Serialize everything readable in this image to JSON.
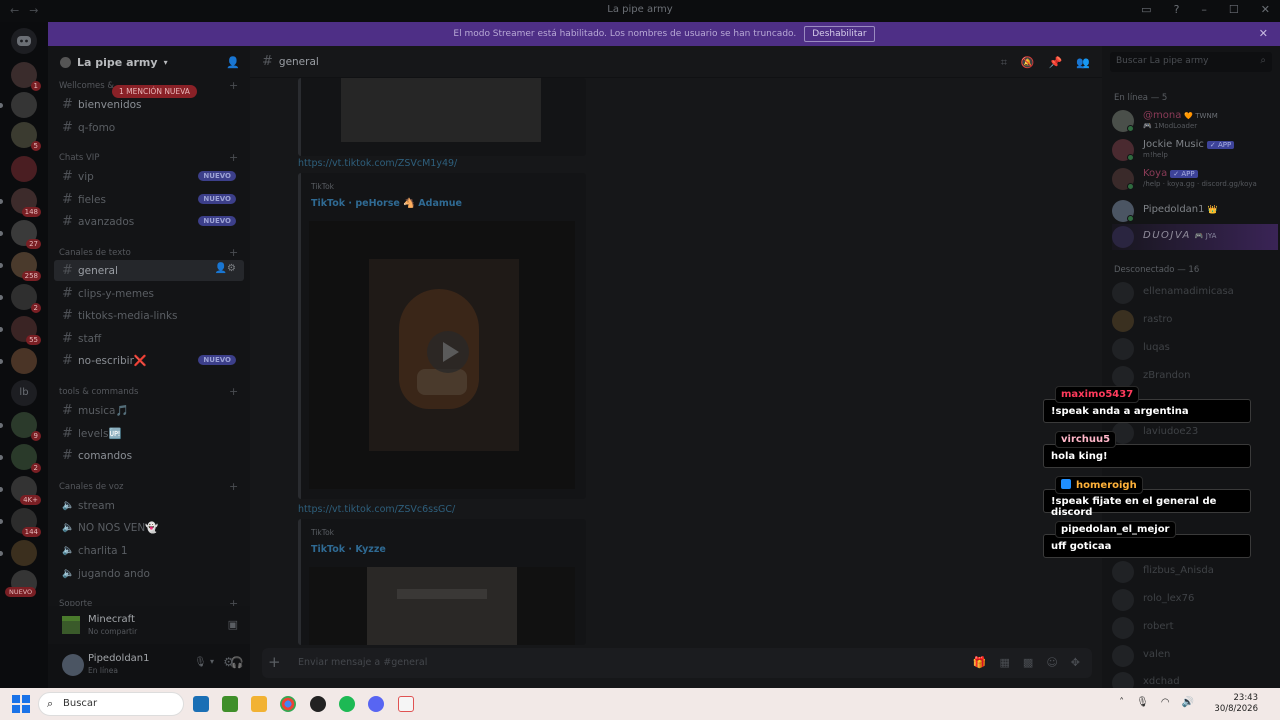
{
  "window": {
    "title": "La pipe army"
  },
  "banner": {
    "text": "El modo Streamer está habilitado. Los nombres de usuario se han truncado.",
    "button": "Deshabilitar"
  },
  "rail_badges": [
    "1",
    "5",
    "148",
    "27",
    "258",
    "2",
    "55",
    "9",
    "2",
    "4K+",
    "144"
  ],
  "rail_text_server": "lb",
  "rail_new": "NUEVO",
  "server": {
    "name": "La pipe army"
  },
  "categories": {
    "welcome": "Wellcomes & ...",
    "vip": "Chats VIP",
    "text": "Canales de texto",
    "tools": "tools & commands",
    "voice": "Canales de voz",
    "support": "Soporte"
  },
  "mention_pill": "1 MENCIÓN NUEVA",
  "channels": {
    "bienvenidos": "bienvenidos",
    "q_fomo": "q-fomo",
    "vip": "vip",
    "fieles": "fieles",
    "avanzados": "avanzados",
    "general": "general",
    "clips": "clips-y-memes",
    "tiktoks": "tiktoks-media-links",
    "staff": "staff",
    "no_escribir": "no-escribir❌",
    "musica": "musica🎵",
    "levels": "levels🆙",
    "comandos": "comandos",
    "stream": "stream",
    "no_nos_ven": "NO NOS VEN👻",
    "charlita": "charlita 1",
    "jugando": "jugando ando"
  },
  "nuevo_label": "NUEVO",
  "activity": {
    "game": "Minecraft",
    "status": "No compartir"
  },
  "user": {
    "name": "Pipedoldan1",
    "status": "En línea"
  },
  "chat": {
    "channel": "general",
    "link1": "https://vt.tiktok.com/ZSVcM1y49/",
    "embed1": {
      "provider": "TikTok",
      "title": "TikTok · peHorse 🐴 Adamue"
    },
    "link2": "https://vt.tiktok.com/ZSVc6ssGC/",
    "embed2": {
      "provider": "TikTok",
      "title": "TikTok · Kyzze"
    },
    "composer_placeholder": "Enviar mensaje a #general"
  },
  "members": {
    "search_placeholder": "Buscar La pipe army",
    "online_header": "En línea — 5",
    "offline_header": "Desconectado — 16",
    "online": [
      {
        "name": "@mona",
        "tag": "🧡 TWNM",
        "status": "🎮 1ModLoader",
        "color": "#8a3b57"
      },
      {
        "name": "Jockie Music",
        "tag": "✓ APP",
        "status": "m!help",
        "color": "#7e8287"
      },
      {
        "name": "Koya",
        "tag": "✓ APP",
        "status": "/help · koya.gg · discord.gg/koya",
        "color": "#8a3b57"
      },
      {
        "name": "Pipedoldan1",
        "tag": "👑",
        "status": "",
        "color": "#7e8287"
      },
      {
        "name": "DUOJVA",
        "tag": "🎮 JYA",
        "status": "",
        "color": "#8f8b9a"
      }
    ],
    "offline_visible": [
      "ellenamadimicasa",
      "rastro",
      "luqas",
      "zBrandon",
      "laviudoe23",
      "flizbus_Anisda",
      "rolo_lex76",
      "robert",
      "valen",
      "xdchad"
    ]
  },
  "stream_chat": [
    {
      "user": "maximo5437",
      "color": "#ff3b5c",
      "message": "!speak anda a argentina",
      "has_icon": false
    },
    {
      "user": "virchuu5",
      "color": "#ffb6c8",
      "message": "hola king!",
      "has_icon": false
    },
    {
      "user": "homeroigh",
      "color": "#ffb23a",
      "message": "!speak fijate en el general de discord",
      "has_icon": true
    },
    {
      "user": "pipedolan_el_mejor",
      "color": "#ffffff",
      "message": "uff goticaa",
      "has_icon": false
    }
  ],
  "taskbar": {
    "search_placeholder": "Buscar",
    "time": "23:43",
    "date": "30/8/2026"
  }
}
